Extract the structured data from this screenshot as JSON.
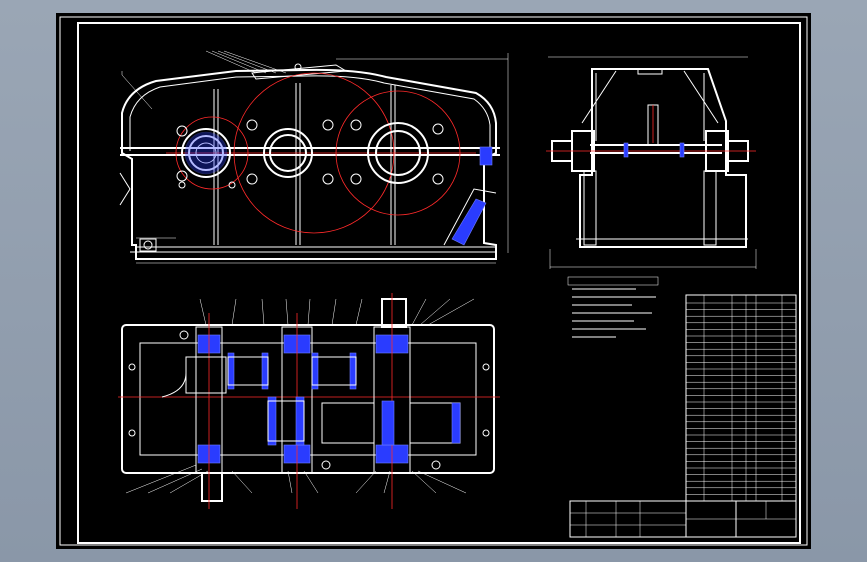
{
  "drawing": {
    "colors": {
      "background": "#000000",
      "outline": "#ffffff",
      "centerline": "#ff2a2a",
      "section_fill": "#2a3cff",
      "frame_bg": "#8a97a8"
    },
    "views": [
      "front-view",
      "side-view",
      "top-section-view"
    ],
    "blocks": [
      "technical-requirements",
      "parts-list",
      "title-block"
    ]
  }
}
